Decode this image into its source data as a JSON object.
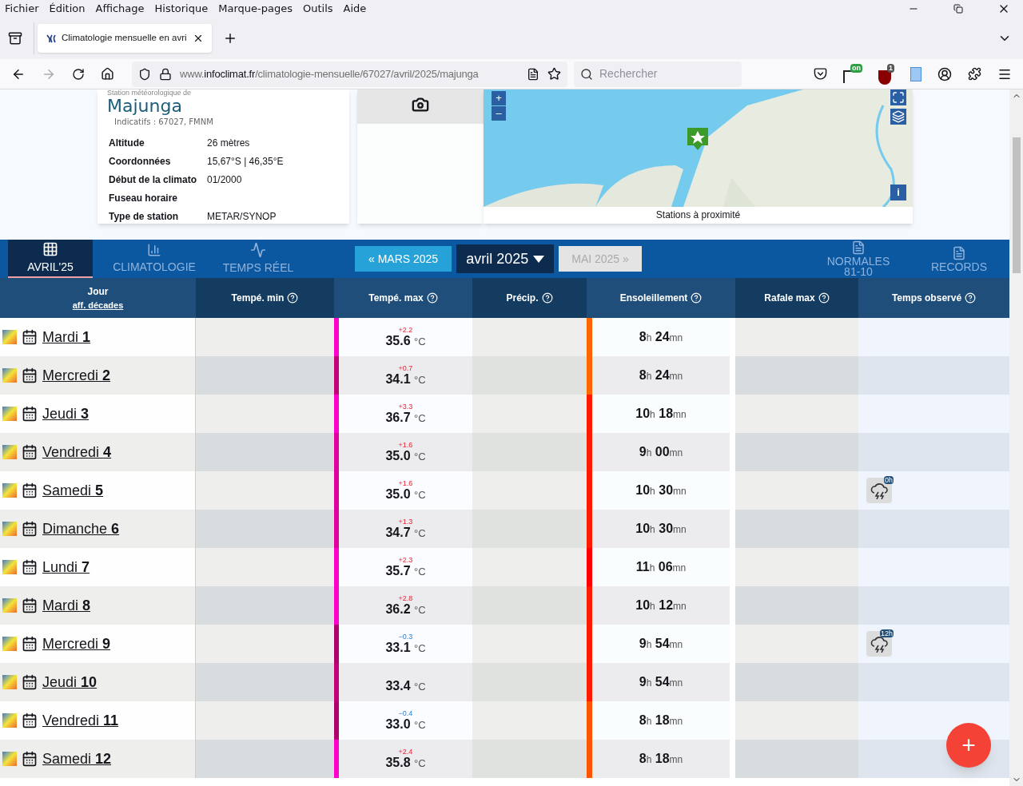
{
  "menu_bar": [
    "Fichier",
    "Édition",
    "Affichage",
    "Historique",
    "Marque-pages",
    "Outils",
    "Aide"
  ],
  "browser_tab": {
    "title": "Climatologie mensuelle en avri",
    "selected": true
  },
  "address_bar": {
    "prefix": "www.",
    "domain": "infoclimat.fr",
    "path": "/climatologie-mensuelle/67027/avril/2025/majunga"
  },
  "search": {
    "placeholder": "Rechercher"
  },
  "extension_badges": [
    "on",
    "1"
  ],
  "station": {
    "caption": "Station météorologique de",
    "name": "Majunga",
    "ids": "Indicatifs : 67027, FMNM",
    "fields": [
      {
        "label": "Altitude",
        "value": "26 mètres"
      },
      {
        "label": "Coordonnées",
        "value": "15,67°S | 46,35°E"
      },
      {
        "label": "Début de la climato",
        "value": "01/2000"
      },
      {
        "label": "Fuseau horaire"
      },
      {
        "label": "Type de station",
        "value": "METAR/SYNOP"
      }
    ]
  },
  "map": {
    "zoom_in": "+",
    "zoom_out": "–",
    "info": "i",
    "caption": "Stations à proximité"
  },
  "nav_tabs": [
    {
      "label": "AVRIL'25",
      "selected": true
    },
    {
      "label": "CLIMATOLOGIE",
      "selected": false
    },
    {
      "label": "TEMPS RÉEL",
      "selected": false
    }
  ],
  "month_nav": {
    "prev": "« MARS 2025",
    "current": "avril 2025",
    "next": "MAI 2025 »",
    "next_disabled": true
  },
  "nav_right": [
    {
      "label": "NORMALES",
      "sub": "81-10"
    },
    {
      "label": "RECORDS"
    }
  ],
  "table": {
    "first_column": {
      "title": "Jour",
      "link": "aff. décades"
    },
    "columns": [
      "Tempé. min",
      "Tempé. max",
      "Précip.",
      "Ensoleillement",
      "Rafale max",
      "Temps observé"
    ],
    "rows": [
      {
        "day": "Mardi",
        "num": "1",
        "tmax": "35.6",
        "unit": "°C",
        "anomaly": "+2.2",
        "tmax_bar": {
          "color": "#ff00cc"
        },
        "sun_h": "8",
        "h": "h",
        "sun_m": "24",
        "mn": "mn",
        "sun_bar": {
          "color": "#ff6600"
        }
      },
      {
        "day": "Mercredi",
        "num": "2",
        "tmax": "34.1",
        "unit": "°C",
        "anomaly": "+0.7",
        "tmax_bar": {
          "color": "#c2007a"
        },
        "sun_h": "8",
        "h": "h",
        "sun_m": "24",
        "mn": "mn",
        "sun_bar": {
          "color": "#ff6600"
        }
      },
      {
        "day": "Jeudi",
        "num": "3",
        "tmax": "36.7",
        "unit": "°C",
        "anomaly": "+3.3",
        "tmax_bar": {
          "color": "#ff00cc"
        },
        "sun_h": "10",
        "h": "h",
        "sun_m": "18",
        "mn": "mn",
        "sun_bar": {
          "color": "#ff1a00"
        }
      },
      {
        "day": "Vendredi",
        "num": "4",
        "tmax": "35.0",
        "unit": "°C",
        "anomaly": "+1.6",
        "tmax_bar": {
          "color": "#e0009e"
        },
        "sun_h": "9",
        "h": "h",
        "sun_m": "00",
        "mn": "mn",
        "sun_bar": {
          "color": "#ff1a00"
        }
      },
      {
        "day": "Samedi",
        "num": "5",
        "tmax": "35.0",
        "unit": "°C",
        "anomaly": "+1.6",
        "tmax_bar": {
          "color": "#e0009e"
        },
        "sun_h": "10",
        "h": "h",
        "sun_m": "30",
        "mn": "mn",
        "sun_bar": {
          "color": "#ff1a00"
        },
        "weather": "0h"
      },
      {
        "day": "Dimanche",
        "num": "6",
        "tmax": "34.7",
        "unit": "°C",
        "anomaly": "+1.3",
        "tmax_bar": {
          "color": "#e0009e"
        },
        "sun_h": "10",
        "h": "h",
        "sun_m": "30",
        "mn": "mn",
        "sun_bar": {
          "color": "#ff1a00"
        }
      },
      {
        "day": "Lundi",
        "num": "7",
        "tmax": "35.7",
        "unit": "°C",
        "anomaly": "+2.3",
        "tmax_bar": {
          "color": "#ff00cc"
        },
        "sun_h": "11",
        "h": "h",
        "sun_m": "06",
        "mn": "mn",
        "sun_bar": {
          "color": "#ff0000"
        }
      },
      {
        "day": "Mardi",
        "num": "8",
        "tmax": "36.2",
        "unit": "°C",
        "anomaly": "+2.8",
        "tmax_bar": {
          "color": "#ff00cc"
        },
        "sun_h": "10",
        "h": "h",
        "sun_m": "12",
        "mn": "mn",
        "sun_bar": {
          "color": "#ff1a00"
        }
      },
      {
        "day": "Mercredi",
        "num": "9",
        "tmax": "33.1",
        "unit": "°C",
        "anomaly": "−0.3",
        "tmax_bar": {
          "color": "#b0006e"
        },
        "sun_h": "9",
        "h": "h",
        "sun_m": "54",
        "mn": "mn",
        "sun_bar": {
          "color": "#ff1a00"
        },
        "weather": "12h"
      },
      {
        "day": "Jeudi",
        "num": "10",
        "tmax": "33.4",
        "unit": "°C",
        "tmax_bar": {
          "color": "#c2007a"
        },
        "sun_h": "9",
        "h": "h",
        "sun_m": "54",
        "mn": "mn",
        "sun_bar": {
          "color": "#ff1a00"
        }
      },
      {
        "day": "Vendredi",
        "num": "11",
        "tmax": "33.0",
        "unit": "°C",
        "anomaly": "−0.4",
        "tmax_bar": {
          "color": "#b0006e"
        },
        "sun_h": "8",
        "h": "h",
        "sun_m": "18",
        "mn": "mn",
        "sun_bar": {
          "color": "#ff5500"
        }
      },
      {
        "day": "Samedi",
        "num": "12",
        "tmax": "35.8",
        "unit": "°C",
        "anomaly": "+2.4",
        "tmax_bar": {
          "color": "#ff00cc"
        },
        "sun_h": "8",
        "h": "h",
        "sun_m": "18",
        "mn": "mn",
        "sun_bar": {
          "color": "#ff5500"
        }
      }
    ]
  },
  "fab": "+"
}
